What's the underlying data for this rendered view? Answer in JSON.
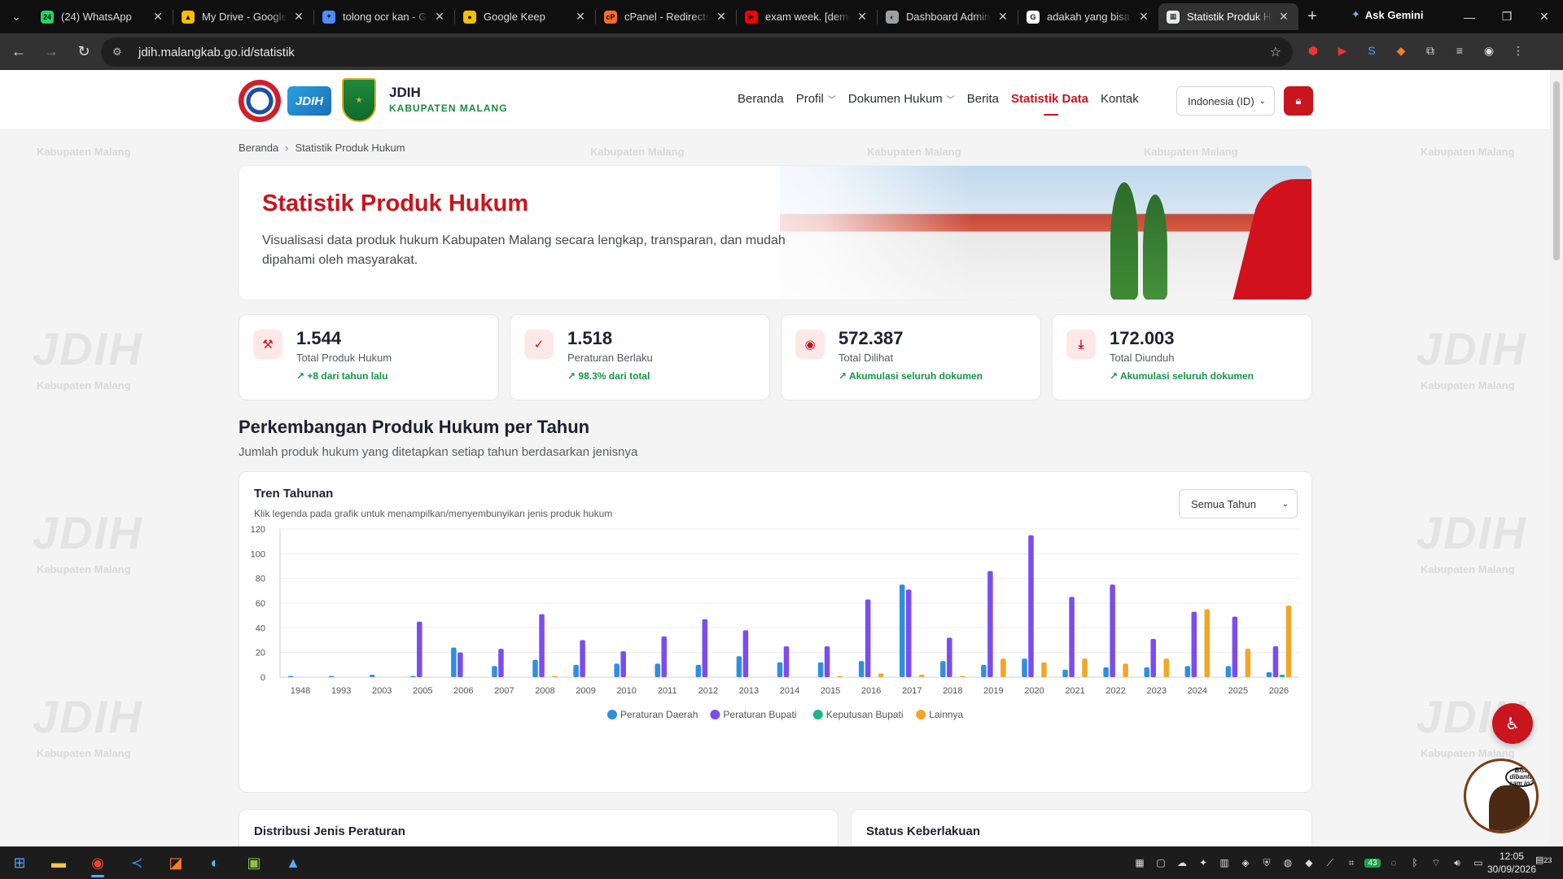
{
  "browser": {
    "tabs": [
      {
        "title": "(24) WhatsApp",
        "favicon_color": "#25d366",
        "favicon_text": "24"
      },
      {
        "title": "My Drive - Google Drive",
        "favicon_color": "#fbbc04",
        "favicon_text": "▲"
      },
      {
        "title": "tolong ocr kan - Gemini",
        "favicon_color": "#4e8cff",
        "favicon_text": "✦"
      },
      {
        "title": "Google Keep",
        "favicon_color": "#f6c000",
        "favicon_text": "●"
      },
      {
        "title": "cPanel - Redirects",
        "favicon_color": "#ff6c2c",
        "favicon_text": "cP"
      },
      {
        "title": "exam week. [demo]",
        "favicon_color": "#ff0000",
        "favicon_text": "▶"
      },
      {
        "title": "Dashboard Admin",
        "favicon_color": "#9aa0a6",
        "favicon_text": "◐"
      },
      {
        "title": "adakah yang bisa m",
        "favicon_color": "#ffffff",
        "favicon_text": "G"
      },
      {
        "title": "Statistik Produk Hukum",
        "favicon_color": "#e8eaed",
        "favicon_text": "▦",
        "active": true
      }
    ],
    "gemini_label": "Ask Gemini",
    "url": "jdih.malangkab.go.id/statistik"
  },
  "site": {
    "brand_title": "JDIH",
    "brand_sub": "KABUPATEN MALANG",
    "logo_text": "JDIH",
    "nav": [
      "Beranda",
      "Profil",
      "Dokumen Hukum",
      "Berita",
      "Statistik Data",
      "Kontak"
    ],
    "language": "Indonesia (ID)",
    "watermark": "Kabupaten Malang",
    "watermark_logo": "JDIH"
  },
  "breadcrumb": {
    "home": "Beranda",
    "current": "Statistik Produk Hukum"
  },
  "hero": {
    "title": "Statistik Produk Hukum",
    "description": "Visualisasi data produk hukum Kabupaten Malang secara lengkap, transparan, dan mudah dipahami oleh masyarakat."
  },
  "stats": [
    {
      "value": "1.544",
      "label": "Total Produk Hukum",
      "trend": "+8 dari tahun lalu",
      "icon": "gavel-icon"
    },
    {
      "value": "1.518",
      "label": "Peraturan Berlaku",
      "trend": "98.3% dari total",
      "icon": "check-circle-icon"
    },
    {
      "value": "572.387",
      "label": "Total Dilihat",
      "trend": "Akumulasi seluruh dokumen",
      "icon": "eye-icon"
    },
    {
      "value": "172.003",
      "label": "Total Diunduh",
      "trend": "Akumulasi seluruh dokumen",
      "icon": "download-icon"
    }
  ],
  "section": {
    "title": "Perkembangan Produk Hukum per Tahun",
    "subtitle": "Jumlah produk hukum yang ditetapkan setiap tahun berdasarkan jenisnya"
  },
  "chart_card": {
    "title": "Tren Tahunan",
    "subtitle": "Klik legenda pada grafik untuk menampilkan/menyembunyikan jenis produk hukum",
    "year_filter": "Semua Tahun"
  },
  "chart_data": {
    "type": "bar",
    "categories": [
      "1948",
      "1993",
      "2003",
      "2005",
      "2006",
      "2007",
      "2008",
      "2009",
      "2010",
      "2011",
      "2012",
      "2013",
      "2014",
      "2015",
      "2016",
      "2017",
      "2018",
      "2019",
      "2020",
      "2021",
      "2022",
      "2023",
      "2024",
      "2025",
      "2026"
    ],
    "ylim": [
      0,
      120
    ],
    "yticks": [
      0,
      20,
      40,
      60,
      80,
      100,
      120
    ],
    "grid": true,
    "legend_position": "bottom",
    "series": [
      {
        "name": "Peraturan Daerah",
        "color": "#2f8ee0",
        "values": [
          1,
          1,
          2,
          1,
          24,
          9,
          14,
          10,
          11,
          11,
          10,
          17,
          12,
          12,
          13,
          75,
          13,
          10,
          15,
          6,
          8,
          8,
          9,
          9,
          4
        ]
      },
      {
        "name": "Peraturan Bupati",
        "color": "#7b4cf0",
        "values": [
          0,
          0,
          0,
          45,
          20,
          23,
          51,
          30,
          21,
          33,
          47,
          38,
          25,
          25,
          63,
          71,
          32,
          86,
          115,
          65,
          75,
          31,
          53,
          49,
          25
        ]
      },
      {
        "name": "Keputusan Bupati",
        "color": "#1ab58a",
        "values": [
          0,
          0,
          0,
          0,
          0,
          0,
          0,
          0,
          0,
          0,
          0,
          0,
          0,
          0,
          0,
          0,
          0,
          0,
          0,
          0,
          0,
          0,
          0,
          0,
          2
        ]
      },
      {
        "name": "Lainnya",
        "color": "#f2a623",
        "values": [
          0,
          0,
          0,
          0,
          0,
          0,
          1,
          0,
          0,
          0,
          0,
          0,
          0,
          1,
          3,
          2,
          1,
          15,
          12,
          15,
          11,
          15,
          55,
          23,
          58
        ]
      }
    ]
  },
  "lower_cards": [
    "Distribusi Jenis Peraturan",
    "Status Keberlakuan"
  ],
  "floating": {
    "mascot_text": "Bisa dibantu sam jo?"
  },
  "taskbar": {
    "time": "12:05",
    "date": "30/09/2026",
    "notif_count": "23",
    "tray_count": "43"
  }
}
